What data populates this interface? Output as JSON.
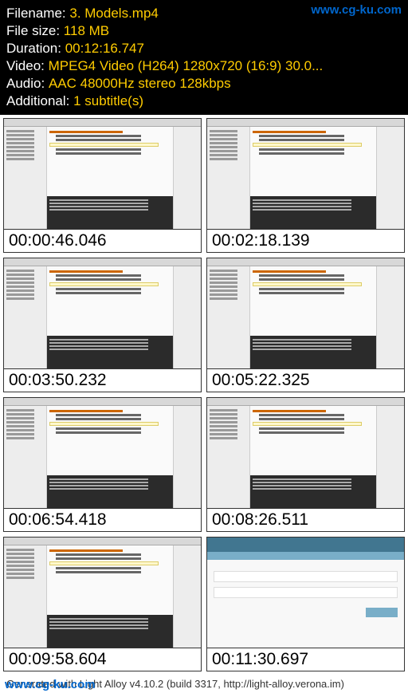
{
  "watermark": {
    "top": "www.cg-ku.com",
    "bottom": "www.cg-ku.com"
  },
  "fileinfo": {
    "filename_label": "Filename: ",
    "filename_value": "3. Models.mp4",
    "filesize_label": "File size: ",
    "filesize_value": "118 MB",
    "duration_label": "Duration: ",
    "duration_value": "00:12:16.747",
    "video_label": "Video: ",
    "video_value": "MPEG4 Video (H264) 1280x720 (16:9) 30.0",
    "audio_label": "Audio: ",
    "audio_value": "AAC 48000Hz stereo 128kbps",
    "additional_label": "Additional: ",
    "additional_value": "1 subtitle(s)"
  },
  "thumbnails": [
    {
      "timestamp": "00:00:46.046",
      "type": "ide"
    },
    {
      "timestamp": "00:02:18.139",
      "type": "ide"
    },
    {
      "timestamp": "00:03:50.232",
      "type": "ide"
    },
    {
      "timestamp": "00:05:22.325",
      "type": "ide"
    },
    {
      "timestamp": "00:06:54.418",
      "type": "ide"
    },
    {
      "timestamp": "00:08:26.511",
      "type": "ide"
    },
    {
      "timestamp": "00:09:58.604",
      "type": "ide"
    },
    {
      "timestamp": "00:11:30.697",
      "type": "django"
    }
  ],
  "footer": {
    "generated": "Generated with Light Alloy v4.10.2 (build 3317, http://light-alloy.verona.im)"
  }
}
